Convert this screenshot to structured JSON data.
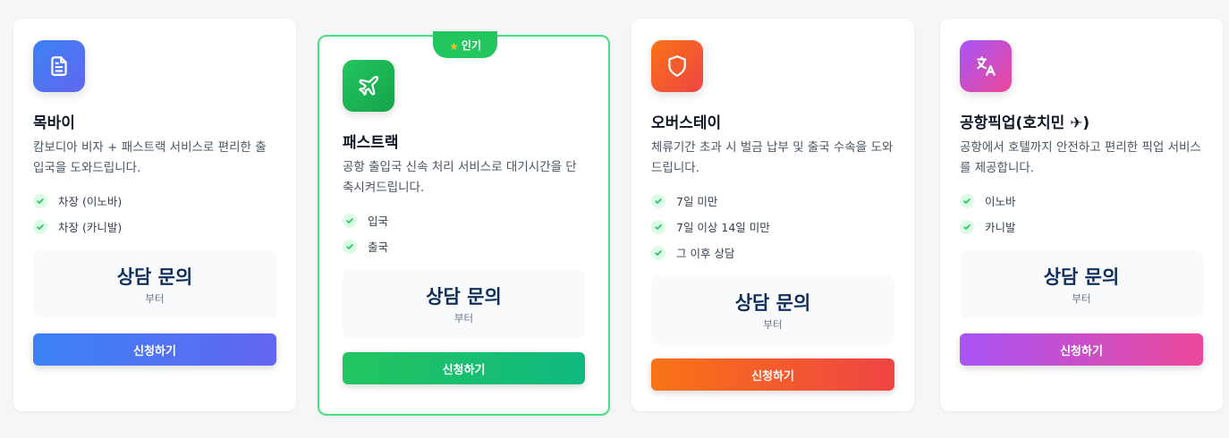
{
  "cards": [
    {
      "icon": "document-icon",
      "title": "목바이",
      "description": "캄보디아 비자 + 패스트랙 서비스로 편리한 출입국을 도와드립니다.",
      "features": [
        "차장 (이노바)",
        "차장 (카니발)"
      ],
      "price": "상담 문의",
      "price_sub": "부터",
      "button": "신청하기"
    },
    {
      "badge": "인기",
      "icon": "airplane-icon",
      "title": "패스트랙",
      "description": "공항 출입국 신속 처리 서비스로 대기시간을 단축시켜드립니다.",
      "features": [
        "입국",
        "출국"
      ],
      "price": "상담 문의",
      "price_sub": "부터",
      "button": "신청하기"
    },
    {
      "icon": "shield-icon",
      "title": "오버스테이",
      "description": "체류기간 초과 시 벌금 납부 및 출국 수속을 도와드립니다.",
      "features": [
        "7일 미만",
        "7일 이상 14일 미만",
        "그 이후 상담"
      ],
      "price": "상담 문의",
      "price_sub": "부터",
      "button": "신청하기"
    },
    {
      "icon": "translate-icon",
      "title": "공항픽업(호치민 ✈)",
      "description": "공항에서 호텔까지 안전하고 편리한 픽업 서비스를 제공합니다.",
      "features": [
        "이노바",
        "카니발"
      ],
      "price": "상담 문의",
      "price_sub": "부터",
      "button": "신청하기"
    }
  ],
  "colors": {
    "blue": "#3b82f6",
    "green": "#22c55e",
    "orange": "#f97316",
    "pink": "#ec4899",
    "price_text": "#0f2f5a"
  }
}
